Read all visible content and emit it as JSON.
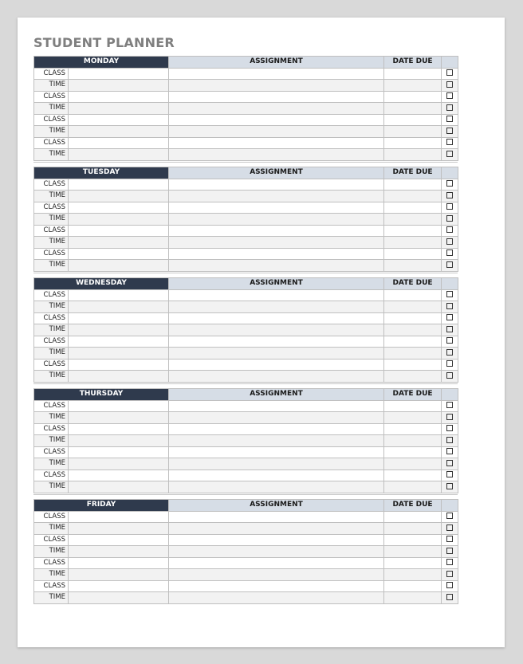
{
  "title": "STUDENT PLANNER",
  "columns": {
    "assignment": "ASSIGNMENT",
    "date_due": "DATE DUE"
  },
  "days": [
    {
      "name": "MONDAY"
    },
    {
      "name": "TUESDAY"
    },
    {
      "name": "WEDNESDAY"
    },
    {
      "name": "THURSDAY"
    },
    {
      "name": "FRIDAY"
    }
  ],
  "row_labels": [
    "CLASS",
    "TIME",
    "CLASS",
    "TIME",
    "CLASS",
    "TIME",
    "CLASS",
    "TIME"
  ],
  "checkbox_icon": "empty-checkbox",
  "colors": {
    "day_header_bg": "#2f3a4d",
    "column_header_bg": "#d6dde6",
    "alt_row_bg": "#f2f2f2",
    "title_color": "#7f7f7f"
  }
}
